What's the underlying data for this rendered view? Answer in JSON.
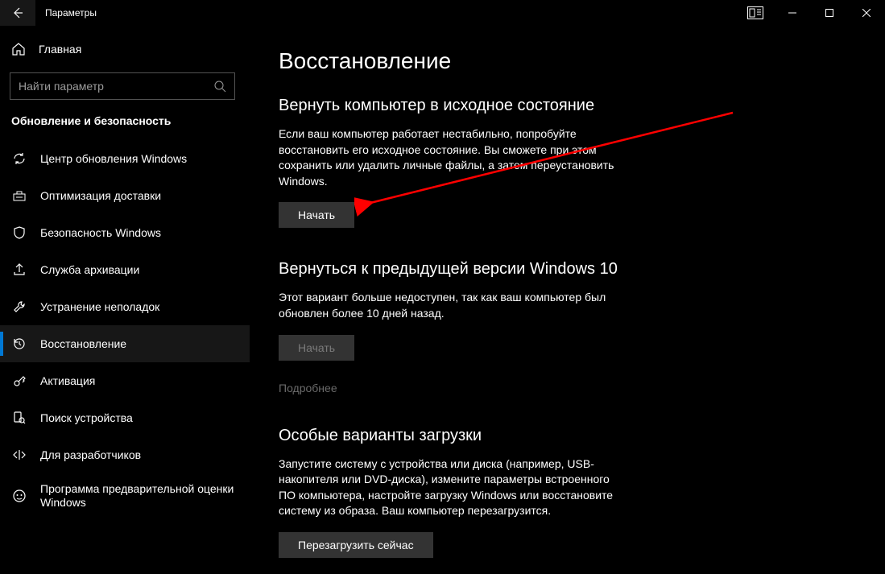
{
  "window": {
    "title": "Параметры"
  },
  "sidebar": {
    "home": "Главная",
    "search_placeholder": "Найти параметр",
    "section": "Обновление и безопасность",
    "items": [
      {
        "icon": "sync",
        "label": "Центр обновления Windows"
      },
      {
        "icon": "delivery",
        "label": "Оптимизация доставки"
      },
      {
        "icon": "shield",
        "label": "Безопасность Windows"
      },
      {
        "icon": "backup",
        "label": "Служба архивации"
      },
      {
        "icon": "wrench",
        "label": "Устранение неполадок"
      },
      {
        "icon": "recovery",
        "label": "Восстановление"
      },
      {
        "icon": "key",
        "label": "Активация"
      },
      {
        "icon": "find",
        "label": "Поиск устройства"
      },
      {
        "icon": "dev",
        "label": "Для разработчиков"
      },
      {
        "icon": "insider",
        "label": "Программа предварительной оценки Windows"
      }
    ],
    "selected_index": 5
  },
  "main": {
    "page_title": "Восстановление",
    "sections": [
      {
        "heading": "Вернуть компьютер в исходное состояние",
        "body": "Если ваш компьютер работает нестабильно, попробуйте восстановить его исходное состояние. Вы сможете при этом сохранить или удалить личные файлы, а затем переустановить Windows.",
        "button": "Начать",
        "button_enabled": true
      },
      {
        "heading": "Вернуться к предыдущей версии Windows 10",
        "body": "Этот вариант больше недоступен, так как ваш компьютер был обновлен более 10 дней назад.",
        "button": "Начать",
        "button_enabled": false,
        "link": "Подробнее"
      },
      {
        "heading": "Особые варианты загрузки",
        "body": "Запустите систему с устройства или диска (например, USB-накопителя или DVD-диска), измените параметры встроенного ПО компьютера, настройте загрузку Windows или восстановите систему из образа. Ваш компьютер перезагрузится.",
        "button": "Перезагрузить сейчас",
        "button_enabled": true
      }
    ]
  }
}
